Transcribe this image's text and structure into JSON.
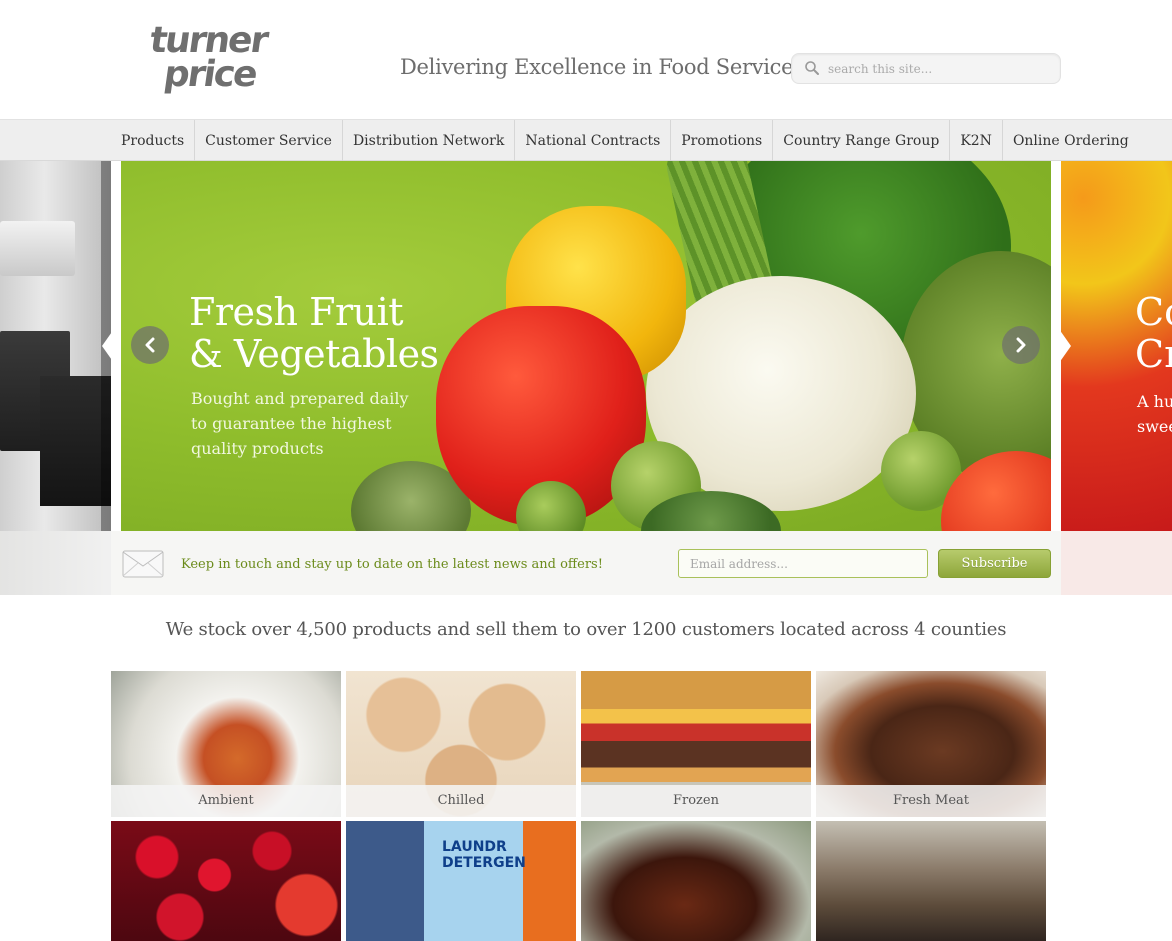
{
  "header": {
    "logo_line1": "turner",
    "logo_line2": "price",
    "tagline": "Delivering Excellence in Food Service",
    "search_placeholder": "search this site..."
  },
  "nav": {
    "items": [
      {
        "label": "Products"
      },
      {
        "label": "Customer Service"
      },
      {
        "label": "Distribution Network"
      },
      {
        "label": "National Contracts"
      },
      {
        "label": "Promotions"
      },
      {
        "label": "Country Range Group"
      },
      {
        "label": "K2N"
      },
      {
        "label": "Online Ordering"
      }
    ]
  },
  "slider": {
    "main": {
      "title_line1": "Fresh Fruit",
      "title_line2": "& Vegetables",
      "sub_line1": "Bought and prepared daily",
      "sub_line2": "to guarantee the highest",
      "sub_line3": "quality products"
    },
    "next_partial": {
      "title_line1": "Co",
      "title_line2": "Cr",
      "sub_line1": "A hu",
      "sub_line2": "swee"
    }
  },
  "newsletter": {
    "text": "Keep in touch and stay up to date on the latest news and offers!",
    "email_placeholder": "Email address...",
    "subscribe_label": "Subscribe"
  },
  "stock_text": "We stock over 4,500 products and sell them to over 1200 customers located across 4 counties",
  "categories": [
    {
      "label": "Ambient"
    },
    {
      "label": "Chilled"
    },
    {
      "label": "Frozen"
    },
    {
      "label": "Fresh Meat"
    }
  ],
  "category_images_row2": {
    "detergent_text_line1": "LAUNDR",
    "detergent_text_line2": "DETERGEN"
  },
  "colors": {
    "accent_green": "#8ea63a",
    "news_text_green": "#6b8b1a",
    "nav_bg": "#eeeeee"
  }
}
